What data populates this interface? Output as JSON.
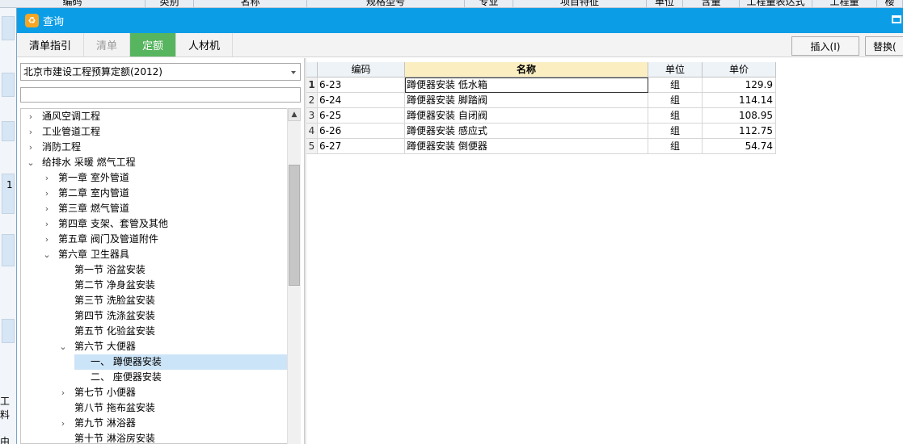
{
  "background": {
    "header": [
      "编码",
      "类别",
      "名称",
      "规格型号",
      "专业",
      "项目特征",
      "单位",
      "含量",
      "工程量表达式",
      "工程量",
      "楼"
    ],
    "left_labels": [
      "1",
      "工料",
      "由"
    ]
  },
  "dialog": {
    "title": "查询",
    "tabs": [
      "清单指引",
      "清单",
      "定额",
      "人材机"
    ],
    "insert_label": "插入(I)",
    "replace_label": "替换("
  },
  "left": {
    "dropdown_value": "北京市建设工程预算定额(2012)",
    "search_value": "",
    "tree": [
      {
        "label": "通风空调工程",
        "level": 0,
        "toggle": "collapsed"
      },
      {
        "label": "工业管道工程",
        "level": 0,
        "toggle": "collapsed"
      },
      {
        "label": "消防工程",
        "level": 0,
        "toggle": "collapsed"
      },
      {
        "label": "给排水 采暖 燃气工程",
        "level": 0,
        "toggle": "expanded"
      },
      {
        "label": "第一章 室外管道",
        "level": 1,
        "toggle": "collapsed"
      },
      {
        "label": "第二章 室内管道",
        "level": 1,
        "toggle": "collapsed"
      },
      {
        "label": "第三章 燃气管道",
        "level": 1,
        "toggle": "collapsed"
      },
      {
        "label": "第四章 支架、套管及其他",
        "level": 1,
        "toggle": "collapsed"
      },
      {
        "label": "第五章 阀门及管道附件",
        "level": 1,
        "toggle": "collapsed"
      },
      {
        "label": "第六章 卫生器具",
        "level": 1,
        "toggle": "expanded"
      },
      {
        "label": "第一节 浴盆安装",
        "level": 2,
        "toggle": "none"
      },
      {
        "label": "第二节 净身盆安装",
        "level": 2,
        "toggle": "none"
      },
      {
        "label": "第三节 洗脸盆安装",
        "level": 2,
        "toggle": "none"
      },
      {
        "label": "第四节 洗涤盆安装",
        "level": 2,
        "toggle": "none"
      },
      {
        "label": "第五节 化验盆安装",
        "level": 2,
        "toggle": "none"
      },
      {
        "label": "第六节 大便器",
        "level": 2,
        "toggle": "expanded"
      },
      {
        "label": "一、 蹲便器安装",
        "level": 3,
        "toggle": "none",
        "selected": true
      },
      {
        "label": "二、 座便器安装",
        "level": 3,
        "toggle": "none"
      },
      {
        "label": "第七节 小便器",
        "level": 2,
        "toggle": "collapsed"
      },
      {
        "label": "第八节 拖布盆安装",
        "level": 2,
        "toggle": "none"
      },
      {
        "label": "第九节 淋浴器",
        "level": 2,
        "toggle": "collapsed"
      },
      {
        "label": "第十节 淋浴房安装",
        "level": 2,
        "toggle": "none"
      }
    ]
  },
  "grid": {
    "columns": [
      "编码",
      "名称",
      "单位",
      "单价"
    ],
    "rows": [
      {
        "no": "1",
        "code": "6-23",
        "name": "蹲便器安装 低水箱",
        "unit": "组",
        "price": "129.9"
      },
      {
        "no": "2",
        "code": "6-24",
        "name": "蹲便器安装 脚踏阀",
        "unit": "组",
        "price": "114.14"
      },
      {
        "no": "3",
        "code": "6-25",
        "name": "蹲便器安装 自闭阀",
        "unit": "组",
        "price": "108.95"
      },
      {
        "no": "4",
        "code": "6-26",
        "name": "蹲便器安装 感应式",
        "unit": "组",
        "price": "112.75"
      },
      {
        "no": "5",
        "code": "6-27",
        "name": "蹲便器安装 倒便器",
        "unit": "组",
        "price": "54.74"
      }
    ]
  },
  "colors": {
    "titlebar": "#0b9ee7",
    "active_tab": "#57b55f",
    "selection": "#cce4f7",
    "name_header": "#fbefc2"
  },
  "icons": [
    "app-icon",
    "maximize-icon",
    "dropdown-arrow-icon",
    "expand-arrow-icon",
    "collapse-arrow-icon",
    "scroll-up-icon"
  ]
}
